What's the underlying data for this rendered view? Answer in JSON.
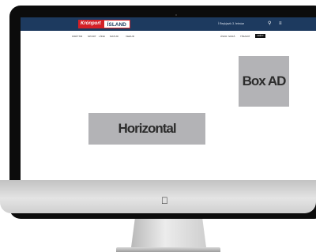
{
  "header": {
    "logo_red": "Krónport",
    "logo_white": "ÍSLAND",
    "date": "Í Reykjavík 3. febrúar",
    "search_icon": "search-icon",
    "menu_icon": "menu-icon"
  },
  "nav": {
    "left_items": [
      "FRÉTTIR",
      "SPORT",
      "LÍFIÐ",
      "MATUR",
      "VEÐUR"
    ],
    "right_items": [
      "ÁSKR.",
      "SKRÁ",
      "TÍMARIT"
    ],
    "button_label": "FRÉTT"
  },
  "ads": {
    "box": "Box AD",
    "horizontal": "Horizontal"
  },
  "colors": {
    "header_bg": "#1d3a5f",
    "logo_red": "#d42027",
    "ad_bg": "#b3b3b6"
  },
  "device": {
    "brand_icon": "apple-logo-icon"
  }
}
